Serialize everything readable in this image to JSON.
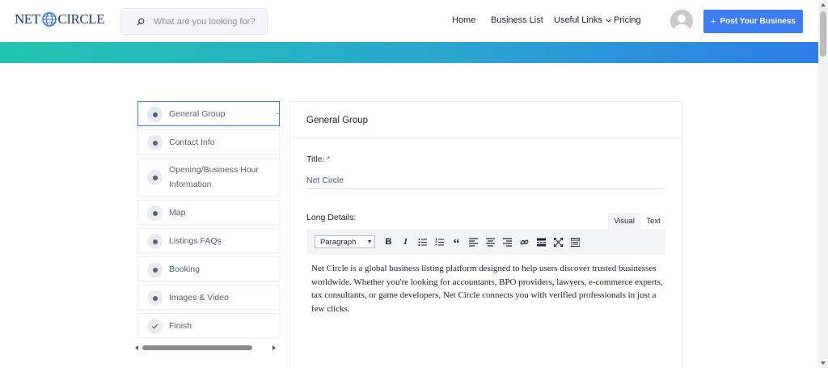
{
  "header": {
    "logo_left": "NET",
    "logo_right": "CIRCLE",
    "search_placeholder": "What are you looking for?",
    "nav": {
      "home": "Home",
      "business_list": "Business List",
      "useful_links": "Useful Links",
      "pricing": "Pricing"
    },
    "post_button_plus": "+",
    "post_button_label": "Post Your Business"
  },
  "colors": {
    "accent": "#3d7cf1",
    "gradient_start": "#22c5b0",
    "gradient_end": "#2d7de6",
    "required": "#e0353d"
  },
  "sidebar": {
    "items": [
      {
        "label": "General Group",
        "active": true,
        "icon": "dot-icon"
      },
      {
        "label": "Contact Info",
        "icon": "dot-icon"
      },
      {
        "label": "Opening/Business Hour Information",
        "icon": "dot-icon"
      },
      {
        "label": "Map",
        "icon": "dot-icon"
      },
      {
        "label": "Listings FAQs",
        "icon": "dot-icon"
      },
      {
        "label": "Booking",
        "icon": "dot-icon"
      },
      {
        "label": "Images & Video",
        "icon": "dot-icon"
      },
      {
        "label": "Finish",
        "icon": "check-icon"
      }
    ]
  },
  "form": {
    "section_title": "General Group",
    "title_label": "Title:",
    "required_mark": "*",
    "title_value": "Net Circle",
    "long_details_label": "Long Details:",
    "editor_tabs": {
      "visual": "Visual",
      "text": "Text"
    },
    "format_select": "Paragraph",
    "toolbar_icons": [
      "bold-icon",
      "italic-icon",
      "bullet-list-icon",
      "numbered-list-icon",
      "blockquote-icon",
      "align-left-icon",
      "align-center-icon",
      "align-right-icon",
      "link-icon",
      "read-more-icon",
      "fullscreen-icon",
      "toolbar-toggle-icon"
    ],
    "bold_glyph": "B",
    "italic_glyph": "I",
    "quote_glyph": "“",
    "editor_content": "Net Circle is a global business listing platform designed to help users discover trusted businesses worldwide. Whether you're looking for accountants, BPO providers, lawyers, e-commerce experts, tax consultants, or game developers, Net Circle connects you with verified professionals in just a few clicks."
  }
}
